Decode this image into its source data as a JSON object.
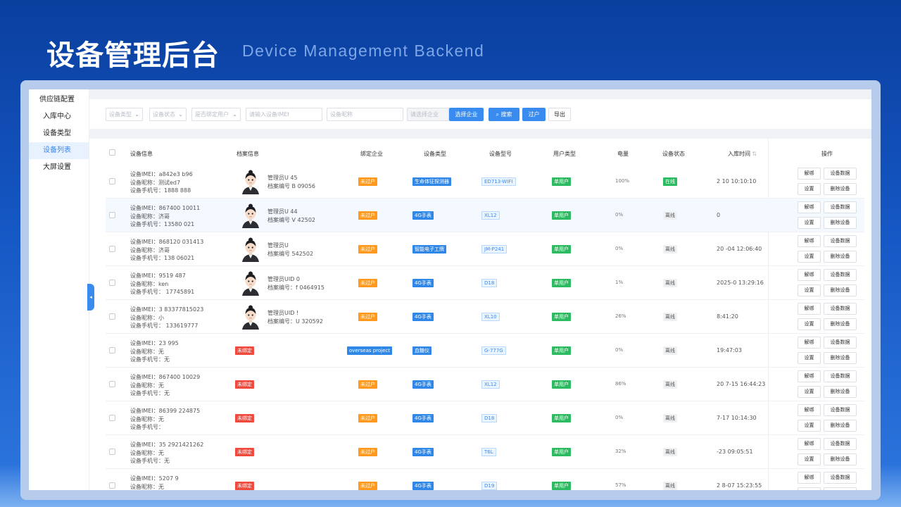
{
  "header": {
    "title": "设备管理后台",
    "subtitle": "Device Management Backend"
  },
  "sidebar": {
    "items": [
      {
        "label": "供应链配置"
      },
      {
        "label": "入库中心"
      },
      {
        "label": "设备类型"
      },
      {
        "label": "设备列表",
        "active": true
      },
      {
        "label": "大屏设置"
      }
    ]
  },
  "filters": {
    "device_type": "设备类型",
    "device_status": "设备状态",
    "bind_user": "是否绑定用户",
    "imei_placeholder": "请输入设备IMEI",
    "name_placeholder": "设备昵称",
    "company_placeholder": "请选择企业",
    "choose_company_label": "选择企业",
    "search_label": "搜索",
    "transfer_label": "过户",
    "export_label": "导出"
  },
  "table": {
    "columns": {
      "device_info": "设备信息",
      "archive_info": "档案信息",
      "bound_company": "绑定企业",
      "device_type": "设备类型",
      "device_model": "设备型号",
      "user_type": "用户类型",
      "battery": "电量",
      "device_status": "设备状态",
      "stock_time": "入库时间",
      "actions": "操作"
    },
    "actions": {
      "unbind": "解绑",
      "device_data": "设备数据",
      "settings": "设置",
      "delete": "删除设备"
    },
    "rows": [
      {
        "imei": "设备IMEI：a842e3  b96",
        "name": "设备昵称：测试ed7",
        "phone": "设备手机号：1888  888",
        "bound": true,
        "manager": "管理员U  45",
        "archive": "档案编号  B  09056",
        "company": "未过户",
        "company_style": "orange",
        "type": "生命体征探测器",
        "model": "ED713-WIFI",
        "user_type": "单用户",
        "battery": "100%",
        "status": "在线",
        "status_style": "green",
        "time": "2  10 10:10:10",
        "highlight": false
      },
      {
        "imei": "设备IMEI：867400  10011",
        "name": "设备昵称：济哥",
        "phone": "设备手机号：13580  021",
        "bound": true,
        "manager": "管理员U  44",
        "archive": "档案编号  V  42502",
        "company": "未过户",
        "company_style": "orange",
        "type": "4G手表",
        "model": "XL12",
        "user_type": "单用户",
        "battery": "0%",
        "status": "离线",
        "status_style": "grey",
        "time": "  0",
        "highlight": true
      },
      {
        "imei": "设备IMEI：868120  031413",
        "name": "设备昵称：济哥",
        "phone": "设备手机号：138  06021",
        "bound": true,
        "manager": "管理员U  ",
        "archive": "档案编号  542502",
        "company": "未过户",
        "company_style": "orange",
        "type": "智能电子工牌",
        "model": "JM-P241",
        "user_type": "单用户",
        "battery": "0%",
        "status": "离线",
        "status_style": "grey",
        "time": "20  -04 12:06:40",
        "highlight": false
      },
      {
        "imei": "设备IMEI：9519  487",
        "name": "设备昵称：ken",
        "phone": "设备手机号：  17745891",
        "bound": true,
        "manager": "管理员UID  0",
        "archive": "档案编号：f  0464915",
        "company": "未过户",
        "company_style": "orange",
        "type": "4G手表",
        "model": "D18",
        "user_type": "单用户",
        "battery": "1%",
        "status": "离线",
        "status_style": "grey",
        "time": "2025-0  13:29:16",
        "highlight": false
      },
      {
        "imei": "设备IMEI：3  83377815023",
        "name": "设备昵称：小",
        "phone": "设备手机号：  133619777",
        "bound": true,
        "manager": "管理员UID  !",
        "archive": "档案编号：U  320592",
        "company": "未过户",
        "company_style": "orange",
        "type": "4G手表",
        "model": "XL10",
        "user_type": "单用户",
        "battery": "26%",
        "status": "离线",
        "status_style": "grey",
        "time": "  8:41:20",
        "highlight": false
      },
      {
        "imei": "设备IMEI：23  995",
        "name": "设备昵称：无",
        "phone": "设备手机号：无",
        "bound": false,
        "unbound_label": "未绑定",
        "company": "overseas project",
        "company_style": "blue",
        "type": "血糖仪",
        "model": "G-777G",
        "user_type": "单用户",
        "battery": "0%",
        "status": "离线",
        "status_style": "grey",
        "time": "  19:47:03",
        "highlight": false
      },
      {
        "imei": "设备IMEI：867400  10029",
        "name": "设备昵称：无",
        "phone": "设备手机号：无",
        "bound": false,
        "unbound_label": "未绑定",
        "company": "未过户",
        "company_style": "orange",
        "type": "4G手表",
        "model": "XL12",
        "user_type": "单用户",
        "battery": "86%",
        "status": "离线",
        "status_style": "grey",
        "time": "20  7-15 16:44:23",
        "highlight": false
      },
      {
        "imei": "设备IMEI：86399  224875",
        "name": "设备昵称：无",
        "phone": "设备手机号：",
        "bound": false,
        "unbound_label": "未绑定",
        "company": "未过户",
        "company_style": "orange",
        "type": "4G手表",
        "model": "D18",
        "user_type": "单用户",
        "battery": "0%",
        "status": "离线",
        "status_style": "grey",
        "time": "  7-17 10:14:30",
        "highlight": false
      },
      {
        "imei": "设备IMEI：35  2921421262",
        "name": "设备昵称：无",
        "phone": "设备手机号：无",
        "bound": false,
        "unbound_label": "未绑定",
        "company": "未过户",
        "company_style": "orange",
        "type": "4G手表",
        "model": "T6L",
        "user_type": "单用户",
        "battery": "32%",
        "status": "离线",
        "status_style": "grey",
        "time": "  -23 09:05:51",
        "highlight": false
      },
      {
        "imei": "设备IMEI：5207  9",
        "name": "设备昵称：无",
        "phone": "设备手机号：无",
        "bound": false,
        "unbound_label": "未绑定",
        "company": "未过户",
        "company_style": "orange",
        "type": "4G手表",
        "model": "D19",
        "user_type": "单用户",
        "battery": "57%",
        "status": "离线",
        "status_style": "grey",
        "time": "2  8-07 15:23:55",
        "highlight": false
      }
    ]
  },
  "colors": {
    "accent": "#3a8bef",
    "orange": "#ff9a1f",
    "green": "#2dbb62",
    "red": "#f04a3e"
  }
}
